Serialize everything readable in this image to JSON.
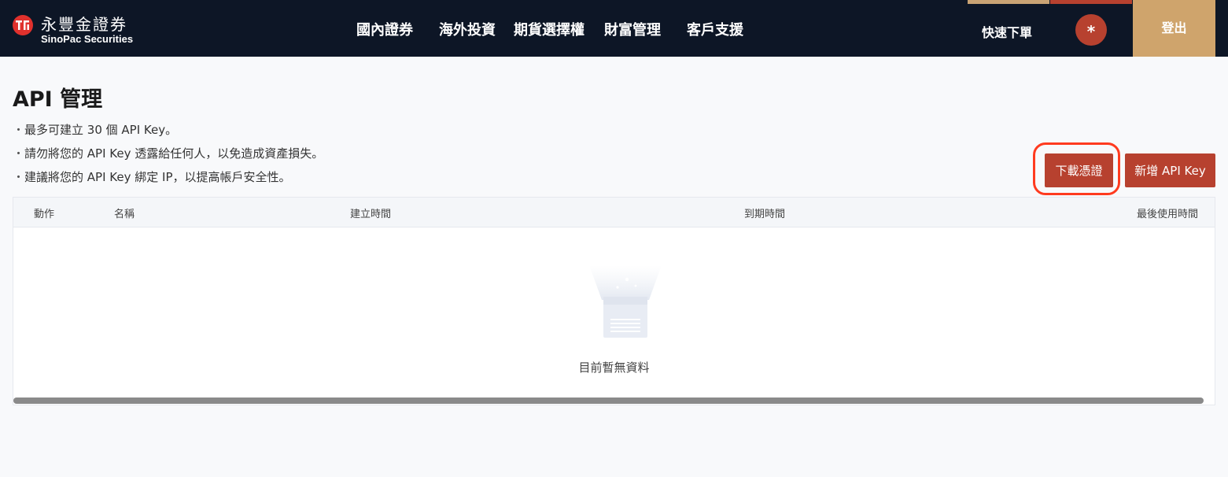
{
  "header": {
    "logo_zh": "永豐金證券",
    "logo_en": "SinoPac Securities",
    "nav": [
      "國內證券",
      "海外投資",
      "期貨選擇權",
      "財富管理",
      "客戶支援"
    ],
    "quick_order": "快速下單",
    "avatar_text": "*",
    "logout": "登出"
  },
  "page": {
    "title": "API 管理",
    "notes": [
      "最多可建立 30 個 API Key。",
      "請勿將您的 API Key 透露給任何人，以免造成資產損失。",
      "建議將您的 API Key 綁定 IP，以提高帳戶安全性。"
    ],
    "buttons": {
      "download": "下載憑證",
      "add": "新增 API Key"
    }
  },
  "table": {
    "columns": [
      "動作",
      "名稱",
      "建立時間",
      "到期時間",
      "最後使用時間"
    ],
    "empty_text": "目前暫無資料"
  },
  "colors": {
    "nav_bg": "#0d1626",
    "accent_red": "#b7412f",
    "accent_gold": "#cfa46c",
    "highlight": "#ff3b1f"
  }
}
